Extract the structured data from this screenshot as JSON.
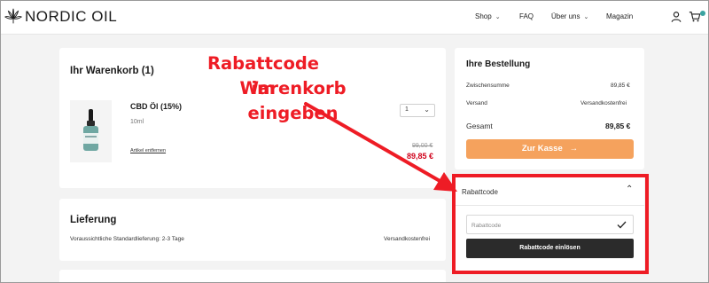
{
  "header": {
    "logo_text": "NORDIC OIL",
    "nav": [
      {
        "label": "Shop",
        "has_dropdown": true
      },
      {
        "label": "FAQ",
        "has_dropdown": false
      },
      {
        "label": "Über uns",
        "has_dropdown": true
      },
      {
        "label": "Magazin",
        "has_dropdown": false
      }
    ],
    "icons": [
      "account-icon",
      "cart-icon"
    ]
  },
  "cart": {
    "title": "Ihr Warenkorb (1)",
    "item": {
      "name": "CBD Öl (15%)",
      "size": "10ml",
      "remove_label": "Artikel entfernen",
      "quantity": "1",
      "old_price": "99,00 €",
      "price": "89,85 €"
    }
  },
  "shipping": {
    "title": "Lieferung",
    "description": "Voraussichtliche Standardlieferung: 2-3 Tage",
    "cost": "Versandkostenfrei"
  },
  "order": {
    "title": "Ihre Bestellung",
    "subtotal_label": "Zwischensumme",
    "subtotal_value": "89,85 €",
    "shipping_label": "Versand",
    "shipping_value": "Versandkostenfrei",
    "total_label": "Gesamt",
    "total_value": "89,85 €",
    "checkout_label": "Zur Kasse",
    "checkout_icon": "arrow-right-icon"
  },
  "coupon": {
    "header_label": "Rabattcode",
    "input_placeholder": "Rabattcode",
    "redeem_label": "Rabattcode einlösen"
  },
  "annotation": {
    "line1": "Rabattcode im",
    "line2": "Warenkorb eingeben",
    "color": "#ee1c25"
  },
  "colors": {
    "accent_orange": "#f5a25d",
    "price_red": "#d0021b",
    "dark_button": "#2b2b2b",
    "background": "#f3f3f3",
    "cart_badge": "#3aa3a0"
  }
}
